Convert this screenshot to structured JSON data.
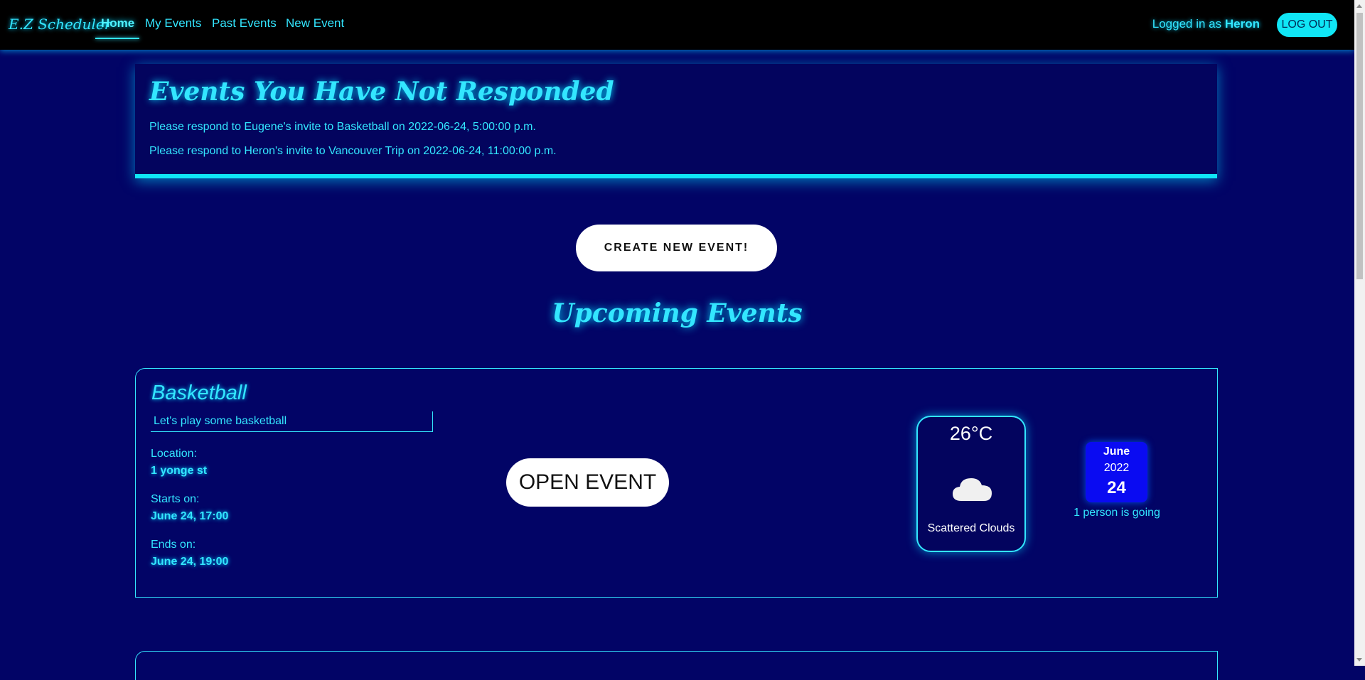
{
  "nav": {
    "brand": "E.Z Scheduler",
    "links": [
      {
        "label": "Home"
      },
      {
        "label": "My Events"
      },
      {
        "label": "Past Events"
      },
      {
        "label": "New Event"
      }
    ],
    "logged_prefix": "Logged in as",
    "user": "Heron",
    "logout": "LOG OUT"
  },
  "pending": {
    "title": "Events You Have Not Responded",
    "items": [
      "Please respond to Eugene's invite to Basketball on 2022-06-24, 5:00:00 p.m.",
      "Please respond to Heron's invite to Vancouver Trip on 2022-06-24, 11:00:00 p.m."
    ]
  },
  "create_button": "CREATE NEW EVENT!",
  "upcoming_title": "Upcoming Events",
  "event": {
    "title": "Basketball",
    "description": "Let's play some basketball",
    "location_label": "Location:",
    "location": "1 yonge st",
    "starts_label": "Starts on:",
    "starts": "June 24, 17:00",
    "ends_label": "Ends on:",
    "ends": "June 24, 19:00",
    "open_button": "OPEN EVENT",
    "weather": {
      "temp": "26°C",
      "icon": "cloud-icon",
      "description": "Scattered Clouds"
    },
    "date": {
      "month": "June",
      "year": "2022",
      "day": "24"
    },
    "going": "1 person is going"
  },
  "colors": {
    "background": "#020466",
    "accent": "#33e6ff",
    "date_badge": "#0a0bf2"
  }
}
